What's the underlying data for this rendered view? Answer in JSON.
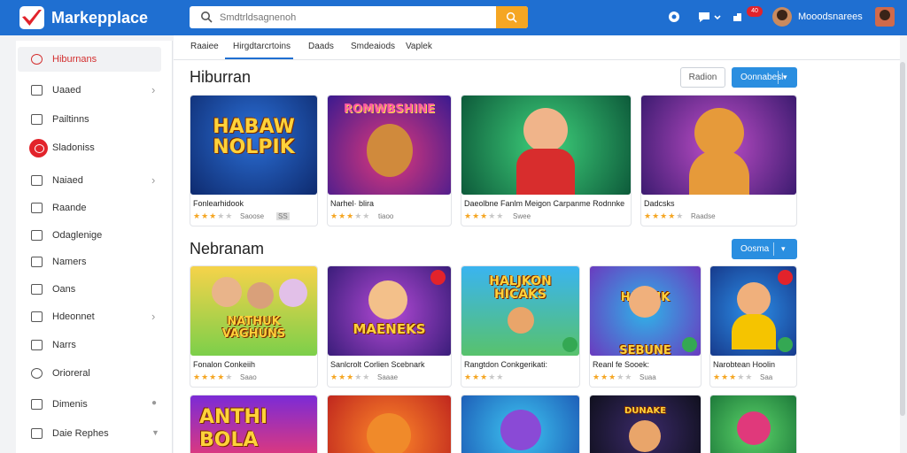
{
  "header": {
    "app_name": "Markepplace",
    "search_placeholder": "Smdtrldsagnenoh",
    "notification_count": "40",
    "user_name": "Mooodsnarees",
    "icons": [
      "search-icon",
      "gift-icon",
      "chat-icon",
      "chevron-down-icon",
      "puzzle-icon",
      "bell-icon"
    ]
  },
  "sidebar": {
    "items": [
      {
        "label": "Hiburnans",
        "icon": "search-icon",
        "active": true
      },
      {
        "label": "Uaaed",
        "icon": "grid-icon"
      },
      {
        "label": "Pailtinns",
        "icon": "bag-icon"
      },
      {
        "label": "Sladoniss",
        "icon": "chat-bubble-icon"
      },
      {
        "label": "Naiaed",
        "icon": "box-icon"
      },
      {
        "label": "Raande",
        "icon": "home-icon"
      },
      {
        "label": "Odaglenige",
        "icon": "image-icon"
      },
      {
        "label": "Namers",
        "icon": "tag-icon"
      },
      {
        "label": "Oans",
        "icon": "calendar-icon"
      },
      {
        "label": "Hdeonnet",
        "icon": "people-icon"
      },
      {
        "label": "Narrs",
        "icon": "document-icon"
      },
      {
        "label": "Orioreral",
        "icon": "search-icon"
      },
      {
        "label": "Dimenis",
        "icon": "list-icon"
      },
      {
        "label": "Daie Rephes",
        "icon": "card-icon"
      }
    ]
  },
  "tabs": [
    "Raaiee",
    "Hirgdtarcrtoins",
    "Daads",
    "Smdeaiods",
    "Vaplek"
  ],
  "section1": {
    "title": "Hiburran",
    "btn_outline": "Radion",
    "btn_blue": "Oonnabesl"
  },
  "section2": {
    "title": "Nebranam",
    "btn_blue": "Oosma"
  },
  "row1": [
    {
      "title": "Fonlearhidook",
      "thumb_text": "HABAW\nNOLPIK",
      "rating": 3,
      "meta": "Saoose",
      "meta2": "SS"
    },
    {
      "title": "Narhel· blira",
      "thumb_text": "ROMWBSHINE",
      "rating": 3.5,
      "meta": "tiaoo",
      "meta2": ""
    },
    {
      "title": "Daeolbne Fanlm Meigon Carpanme Rodnnke",
      "thumb_text": "",
      "rating": 3.5,
      "meta": "Swee",
      "meta2": ""
    },
    {
      "title": "Dadcsks",
      "thumb_text": "",
      "rating": 4,
      "meta": "Raadse",
      "meta2": ""
    }
  ],
  "row2": [
    {
      "title": "Fonalon Conkeiih",
      "thumb_text": "NATHUK\nVAGHUNS",
      "rating": 4,
      "meta": "Saao",
      "meta2": ""
    },
    {
      "title": "Sanlcrolt Corlien Scebnark",
      "thumb_text": "MAENEKS",
      "rating": 3,
      "meta": "Saaae",
      "meta2": ""
    },
    {
      "title": "Rangtdon Conkgerikati:",
      "thumb_text": "HALJKON\nHICAKS",
      "rating": 3,
      "meta": "",
      "meta2": ""
    },
    {
      "title": "Reanl fe Sooek:",
      "thumb_text": "HAENIK\nSEBUNE",
      "rating": 3.5,
      "meta": "Suaa",
      "meta2": ""
    },
    {
      "title": "Narobtean Hoolin",
      "thumb_text": "",
      "rating": 3,
      "meta": "Saa",
      "meta2": ""
    }
  ],
  "row3": [
    {
      "thumb_text": "ANTHI\nBOLA"
    },
    {
      "thumb_text": ""
    },
    {
      "thumb_text": ""
    },
    {
      "thumb_text": "DUNAKE"
    },
    {
      "thumb_text": ""
    }
  ],
  "colors": {
    "header_bg": "#1f6fd1",
    "accent_orange": "#f5a623",
    "accent_red": "#e2232b",
    "button_blue": "#2a8ee0",
    "star": "#f5a623"
  }
}
